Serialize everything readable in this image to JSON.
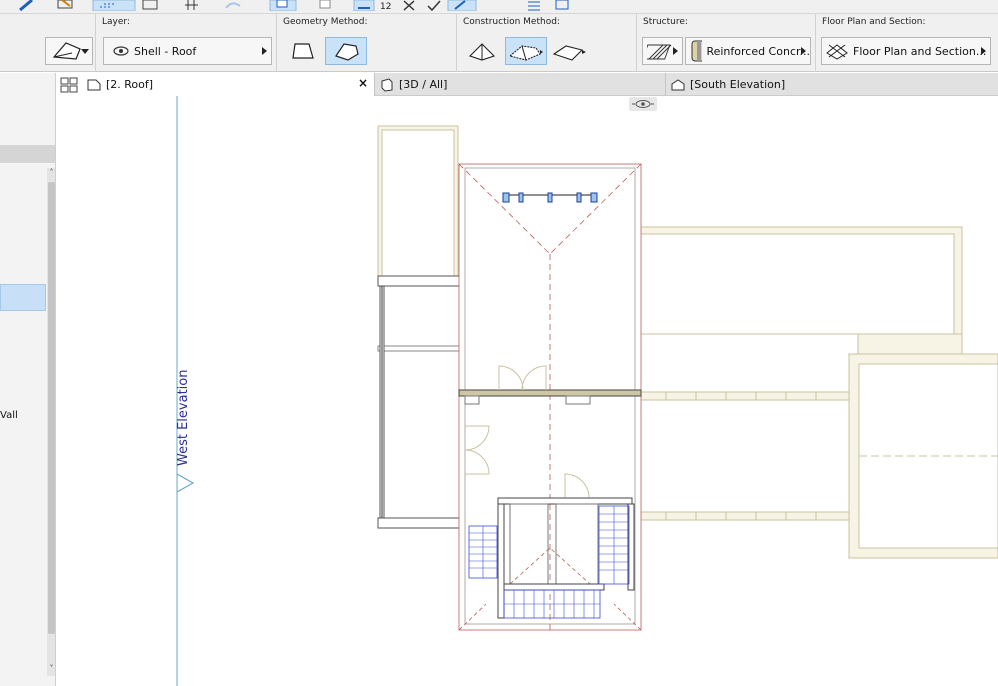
{
  "infobox": {
    "layer": {
      "label": "Layer:",
      "value": "Shell - Roof"
    },
    "geometry": {
      "label": "Geometry Method:"
    },
    "construction": {
      "label": "Construction Method:"
    },
    "structure": {
      "label": "Structure:",
      "value": "Reinforced Concr..."
    },
    "floorplan": {
      "label": "Floor Plan and Section:",
      "value": "Floor Plan and Section..."
    }
  },
  "tabs": [
    {
      "label": "[2. Roof]",
      "active": true
    },
    {
      "label": "[3D / All]",
      "active": false
    },
    {
      "label": "[South Elevation]",
      "active": false
    }
  ],
  "tab_close": "×",
  "left_panel": {
    "partial_label": "Vall",
    "scroll_up": "˄",
    "scroll_down": "˅"
  },
  "canvas": {
    "elevation_marker": "West Elevation"
  },
  "colors": {
    "wall_fill": "#f7f4e6",
    "wall_stroke": "#c9c3a0",
    "roof_line": "#c05a5a",
    "stair": "#3d4fd6",
    "elevation_line": "#6aa8c9",
    "elevation_text": "#2b2f9a",
    "selected_button": "#c9e2f8"
  },
  "icons": [
    "roof-tool-icon",
    "eye-icon",
    "polygon-icon",
    "rectangle-roof-icon",
    "multi-plane-roof-icon",
    "hip-roof-icon",
    "gable-roof-icon",
    "structure-basic-icon",
    "composite-icon",
    "floorplan-section-icon",
    "grid-view-icon",
    "floor-plan-tab-icon",
    "3d-tab-icon",
    "elevation-tab-icon",
    "close-icon"
  ]
}
